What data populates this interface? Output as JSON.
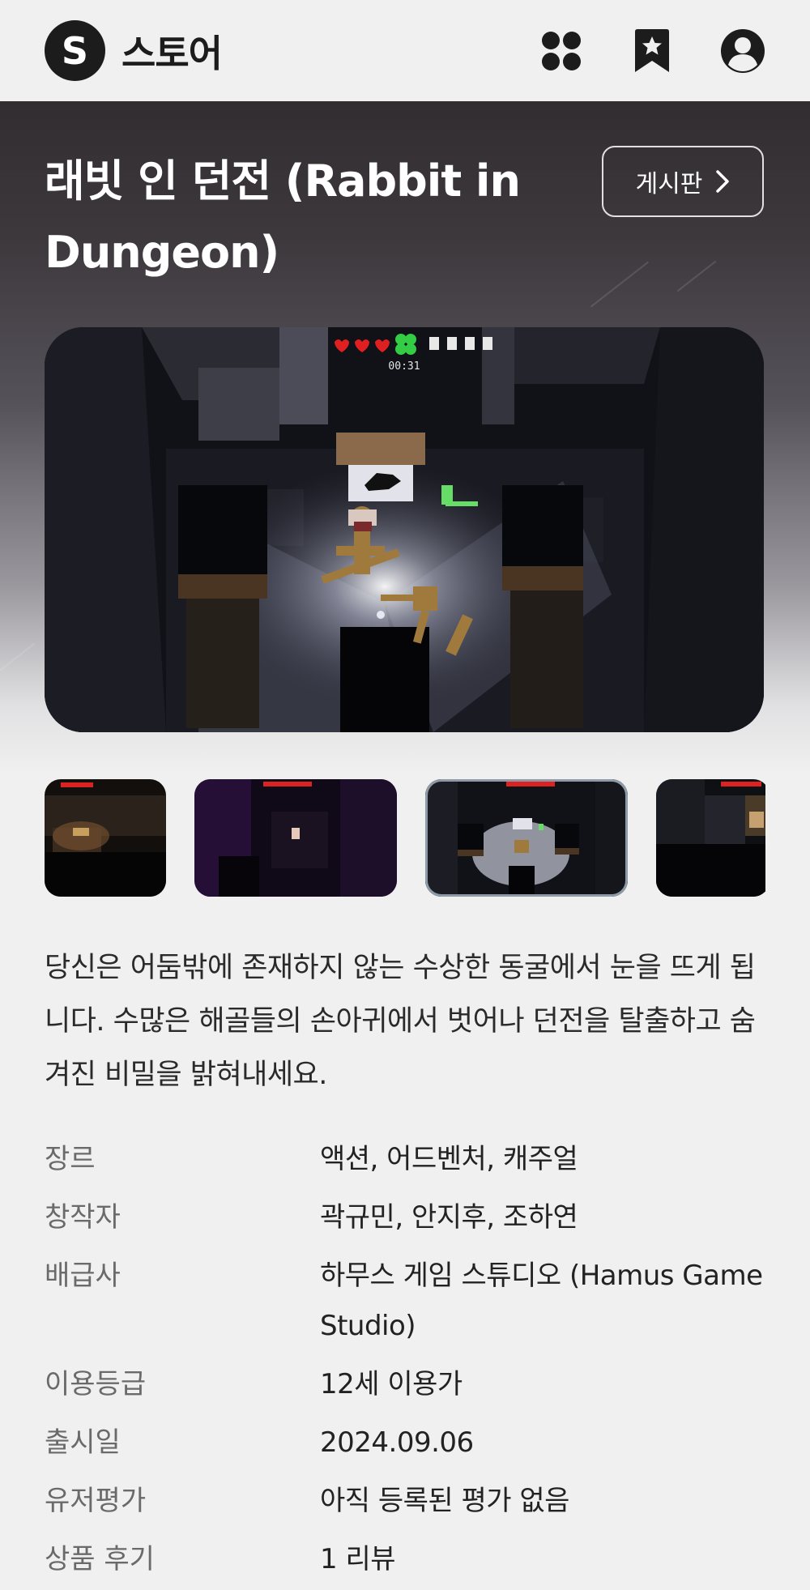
{
  "header": {
    "logo_letter": "S",
    "title": "스토어",
    "icons": [
      "apps-icon",
      "bookmark-star-icon",
      "account-icon"
    ]
  },
  "game": {
    "title": "래빗 인 던전 (Rabbit in Dungeon)",
    "board_button": "게시판",
    "hud_timer": "00:31",
    "description": "당신은 어둠밖에 존재하지 않는 수상한 동굴에서 눈을 뜨게 됩니다. 수많은 해골들의 손아귀에서 벗어나 던전을 탈출하고 숨겨진 비밀을 밝혀내세요."
  },
  "info": [
    {
      "label": "장르",
      "value": "액션, 어드벤처, 캐주얼"
    },
    {
      "label": "창작자",
      "value": "곽규민, 안지후, 조하연"
    },
    {
      "label": "배급사",
      "value": "하무스 게임 스튜디오 (Hamus Game Studio)"
    },
    {
      "label": "이용등급",
      "value": "12세 이용가"
    },
    {
      "label": "출시일",
      "value": "2024.09.06"
    },
    {
      "label": "유저평가",
      "value": "아직 등록된 평가 없음"
    },
    {
      "label": "상품 후기",
      "value": "1 리뷰"
    }
  ],
  "colors": {
    "logo_bg": "#1c1c1c",
    "page_bg": "#f0f0f0",
    "hero_top": "#322d31",
    "selected_thumb_border": "#8e9aa6"
  }
}
